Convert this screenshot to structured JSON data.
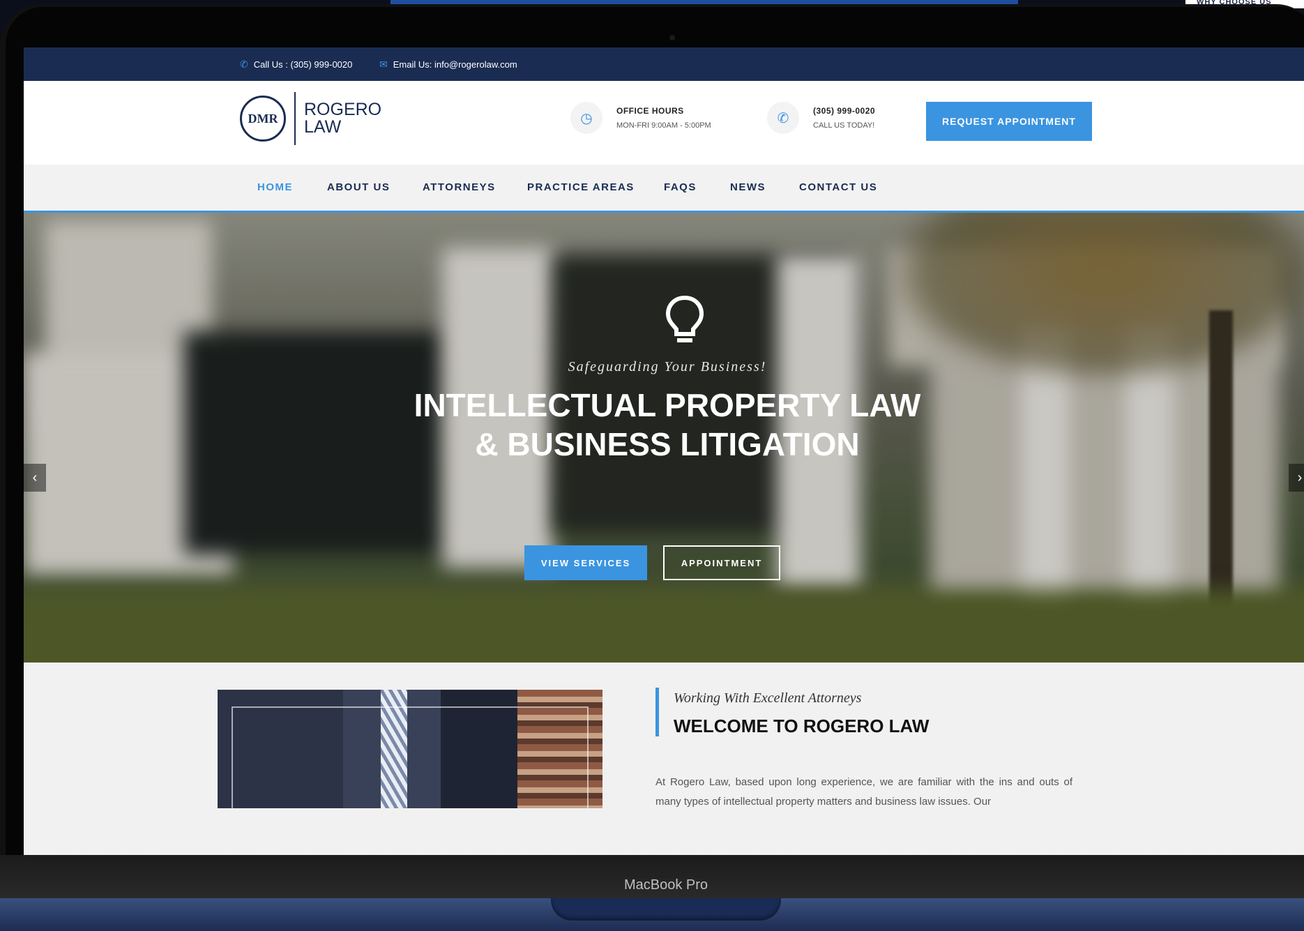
{
  "device": {
    "label": "MacBook Pro"
  },
  "backdrop": {
    "corner_text": "WHY CHOOSE US"
  },
  "topbar": {
    "phone": "Call Us : (305) 999-0020",
    "email": "Email Us: info@rogerolaw.com"
  },
  "header": {
    "logo_mark": "DMR",
    "logo_line1": "ROGERO",
    "logo_line2": "LAW",
    "hours_label": "OFFICE HOURS",
    "hours_value": "MON-FRI 9:00AM - 5:00PM",
    "phone_label": "(305) 999-0020",
    "phone_sub": "CALL US TODAY!",
    "cta": "REQUEST APPOINTMENT"
  },
  "nav": {
    "items": [
      "HOME",
      "ABOUT US",
      "ATTORNEYS",
      "PRACTICE AREAS",
      "FAQS",
      "NEWS",
      "CONTACT US"
    ],
    "active_index": 0
  },
  "hero": {
    "tagline": "Safeguarding Your Business!",
    "title_line1": "INTELLECTUAL PROPERTY LAW",
    "title_line2": "& BUSINESS LITIGATION",
    "btn_primary": "VIEW SERVICES",
    "btn_secondary": "APPOINTMENT",
    "prev": "‹",
    "next": "›"
  },
  "welcome": {
    "tagline": "Working With Excellent Attorneys",
    "title": "WELCOME TO ROGERO LAW",
    "body": "At Rogero Law, based upon long experience, we are familiar with the ins and outs of many types of intellectual property matters and business law issues. Our"
  },
  "colors": {
    "navy": "#1a2c52",
    "accent": "#3b94e0"
  }
}
